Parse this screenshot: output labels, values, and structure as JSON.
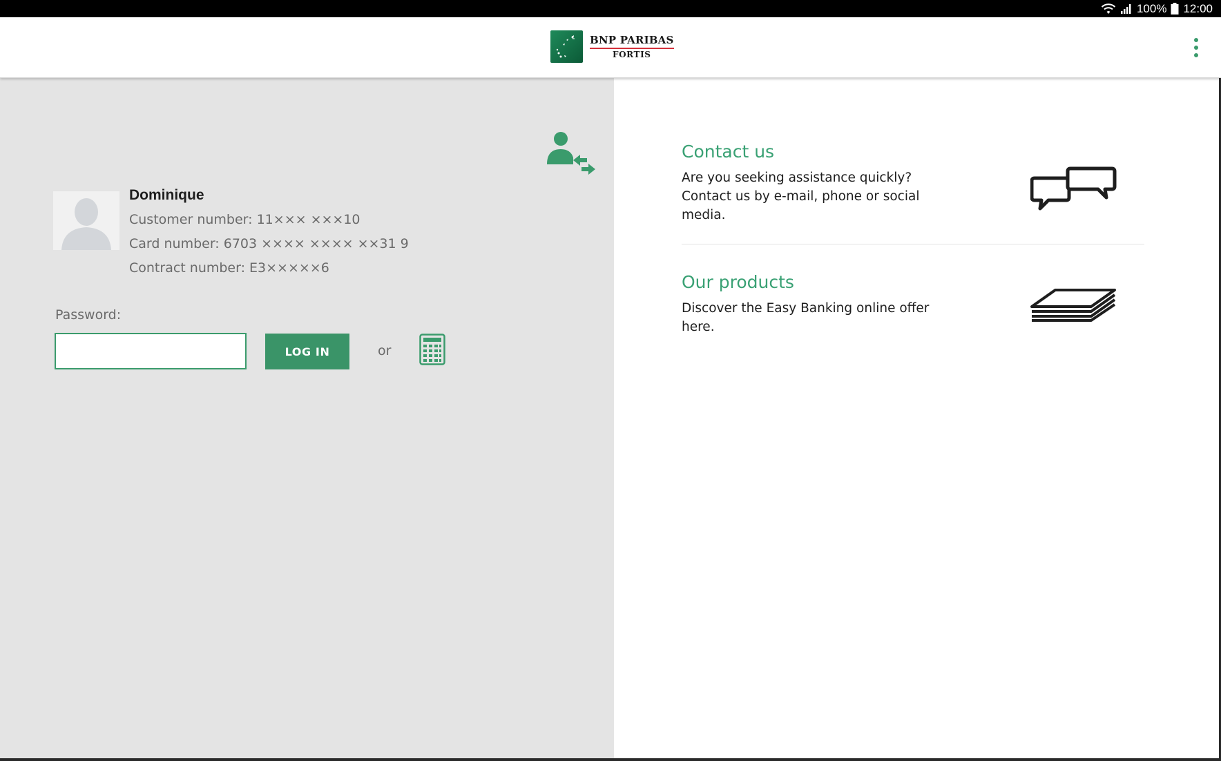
{
  "status_bar": {
    "battery": "100%",
    "time": "12:00"
  },
  "header": {
    "brand_line1": "BNP PARIBAS",
    "brand_line2": "FORTIS",
    "menu_icon": "overflow-menu-icon"
  },
  "login": {
    "user": {
      "name": "Dominique",
      "customer_number": "Customer number: 11××× ×××10",
      "card_number": "Card number: 6703 ×××× ×××× ××31 9",
      "contract_number": "Contract number: E3×××××6"
    },
    "password_label": "Password:",
    "password_value": "",
    "login_button": "LOG IN",
    "or_text": "or",
    "switch_user_icon": "switch-user-icon",
    "card_reader_icon": "calculator-icon"
  },
  "cards": [
    {
      "title": "Contact us",
      "text": "Are you seeking assistance quickly? Contact us by e-mail, phone or social media.",
      "icon": "chat-bubbles-icon"
    },
    {
      "title": "Our products",
      "text": "Discover the Easy Banking online offer here.",
      "icon": "stacked-papers-icon"
    }
  ],
  "colors": {
    "accent": "#3a9b6c",
    "button": "#3a9468",
    "title_green": "#3aa174",
    "left_bg": "#e4e4e4",
    "brand_red": "#d4303a"
  }
}
